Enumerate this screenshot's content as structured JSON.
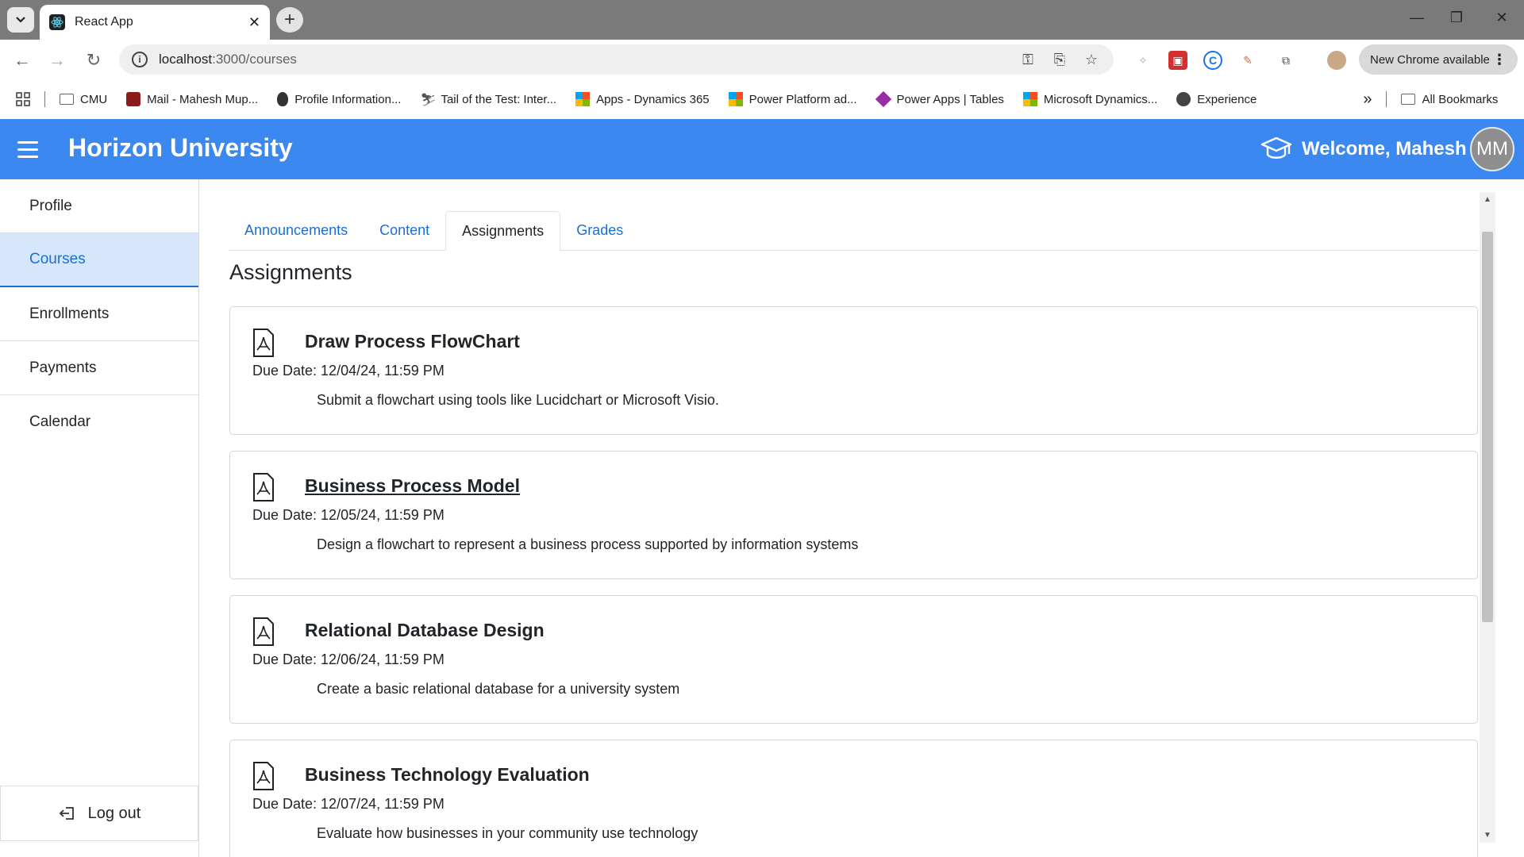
{
  "browser": {
    "tab_title": "React App",
    "tab_close": "✕",
    "new_tab": "+",
    "url_host": "localhost",
    "url_path": ":3000/courses",
    "update_label": "New Chrome available",
    "bookmarks": [
      {
        "label": "CMU",
        "icon": "folder-icon"
      },
      {
        "label": "Mail - Mahesh Mup...",
        "icon": "mail-icon"
      },
      {
        "label": "Profile Information...",
        "icon": "apple-icon"
      },
      {
        "label": "Tail of the Test: Inter...",
        "icon": "runner-icon"
      },
      {
        "label": "Apps - Dynamics 365",
        "icon": "microsoft-icon"
      },
      {
        "label": "Power Platform ad...",
        "icon": "microsoft-icon"
      },
      {
        "label": "Power Apps | Tables",
        "icon": "powerapps-icon"
      },
      {
        "label": "Microsoft Dynamics...",
        "icon": "microsoft-icon"
      },
      {
        "label": "Experience",
        "icon": "globe-icon"
      }
    ],
    "all_bookmarks": "All Bookmarks",
    "overflow": "»"
  },
  "app": {
    "brand": "Horizon University",
    "welcome": "Welcome, Mahesh",
    "avatar_initials": "MM"
  },
  "sidebar": {
    "items": [
      "Profile",
      "Courses",
      "Enrollments",
      "Payments",
      "Calendar"
    ],
    "active": "Courses",
    "logout": "Log out"
  },
  "course_tabs": [
    "Announcements",
    "Content",
    "Assignments",
    "Grades"
  ],
  "active_tab": "Assignments",
  "section_title": "Assignments",
  "assignments": [
    {
      "title": "Draw Process FlowChart",
      "due": "Due Date: 12/04/24, 11:59 PM",
      "description": "Submit a flowchart using tools like Lucidchart or Microsoft Visio."
    },
    {
      "title": "Business Process Model",
      "due": "Due Date: 12/05/24, 11:59 PM",
      "description": "Design a flowchart to represent a business process supported by information systems"
    },
    {
      "title": "Relational Database Design",
      "due": "Due Date: 12/06/24, 11:59 PM",
      "description": "Create a basic relational database for a university system"
    },
    {
      "title": "Business Technology Evaluation",
      "due": "Due Date: 12/07/24, 11:59 PM",
      "description": "Evaluate how businesses in your community use technology"
    }
  ],
  "colors": {
    "appbar": "#3b88f0",
    "link": "#1a6fd6",
    "active_side_bg": "#d6e6fb"
  }
}
